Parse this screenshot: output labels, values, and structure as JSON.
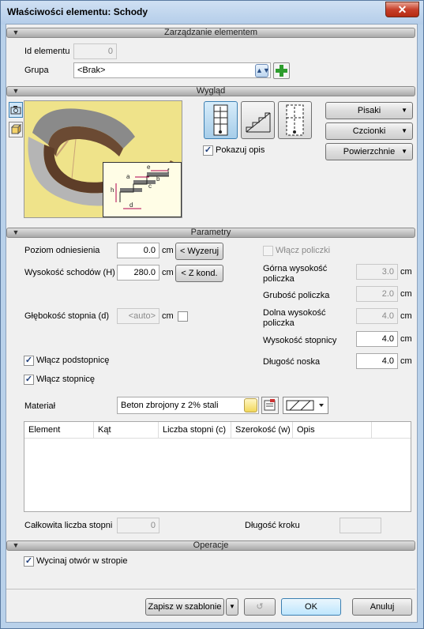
{
  "window": {
    "title": "Właściwości elementu: Schody",
    "close_glyph": "✕"
  },
  "sections": {
    "management": "Zarządzanie elementem",
    "appearance": "Wygląd",
    "parameters": "Parametry",
    "operations": "Operacje"
  },
  "management": {
    "id_label": "Id elementu",
    "id_value": "0",
    "group_label": "Grupa",
    "group_value": "<Brak>"
  },
  "appearance": {
    "show_description_label": "Pokazuj opis",
    "show_description_checked": true,
    "pens_button": "Pisaki",
    "fonts_button": "Czcionki",
    "surfaces_button": "Powierzchnie",
    "dim_labels": [
      "e",
      "a",
      "b",
      "h",
      "f",
      "c",
      "d"
    ]
  },
  "parameters": {
    "ref_level_label": "Poziom odniesienia",
    "ref_level_value": "0.0",
    "ref_level_unit": "cm",
    "ref_level_button": "< Wyzeruj",
    "stair_height_label": "Wysokość schodów (H)",
    "stair_height_value": "280.0",
    "stair_height_unit": "cm",
    "stair_height_button": "< Z kond.",
    "step_depth_label": "Głębokość stopnia (d)",
    "step_depth_value": "<auto>",
    "step_depth_unit": "cm",
    "riser_label": "Włącz podstopnicę",
    "riser_checked": true,
    "tread_label": "Włącz stopnicę",
    "tread_checked": true,
    "stringer_label": "Włącz policzki",
    "stringer_checked": false,
    "top_stringer_label_1": "Górna wysokość",
    "top_stringer_label_2": "policzka",
    "top_stringer_value": "3.0",
    "stringer_thickness_label": "Grubość policzka",
    "stringer_thickness_value": "2.0",
    "bottom_stringer_label_1": "Dolna wysokość",
    "bottom_stringer_label_2": "policzka",
    "bottom_stringer_value": "4.0",
    "tread_height_label": "Wysokość stopnicy",
    "tread_height_value": "4.0",
    "nosing_label": "Długość noska",
    "nosing_value": "4.0",
    "unit": "cm",
    "material_label": "Materiał",
    "material_value": "Beton zbrojony z 2% stali",
    "table_headers": [
      "Element",
      "Kąt",
      "Liczba stopni (c)",
      "Szerokość (w)",
      "Opis"
    ],
    "total_steps_label": "Całkowita liczba stopni",
    "total_steps_value": "0",
    "step_length_label": "Długość kroku",
    "step_length_value": ""
  },
  "operations": {
    "cut_opening_label": "Wycinaj otwór w stropie",
    "cut_opening_checked": true
  },
  "footer": {
    "save_template": "Zapisz w szablonie",
    "ok": "OK",
    "cancel": "Anuluj"
  },
  "colors": {
    "accent_green": "#2e9d2e",
    "selection_blue": "#3c7fb1",
    "preview_bg": "#efe38a"
  }
}
